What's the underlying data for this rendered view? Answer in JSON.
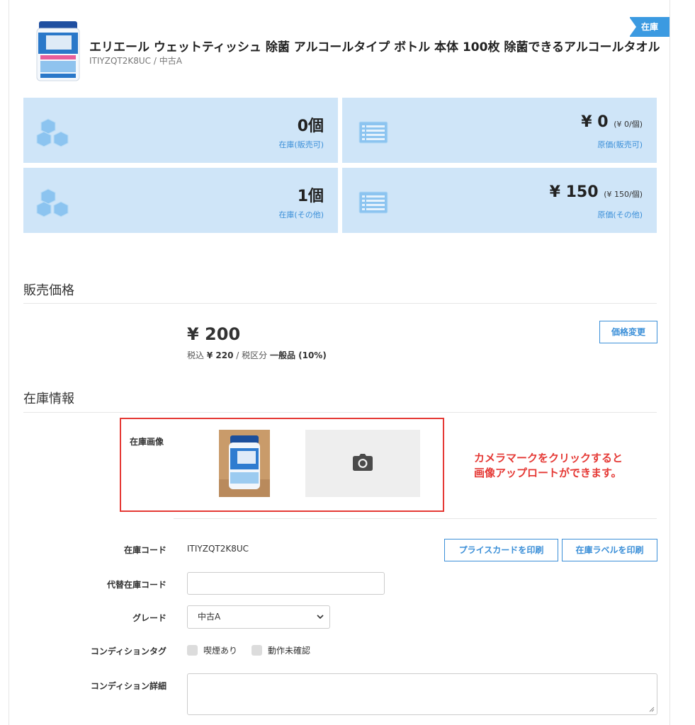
{
  "header": {
    "badge": "在庫",
    "title": "エリエール ウェットティッシュ 除菌 アルコールタイプ ボトル 本体 100枚 除菌できるアルコールタオル",
    "subtitle": "ITIYZQT2K8UC / 中古A"
  },
  "stats": [
    {
      "value": "0個",
      "sub": "",
      "label": "在庫(販売可)",
      "icon": "cubes-icon"
    },
    {
      "value": "¥ 0",
      "sub": "(¥ 0/個)",
      "label": "原価(販売可)",
      "icon": "list-icon"
    },
    {
      "value": "1個",
      "sub": "",
      "label": "在庫(その他)",
      "icon": "cubes-icon"
    },
    {
      "value": "¥ 150",
      "sub": "(¥ 150/個)",
      "label": "原価(その他)",
      "icon": "list-icon"
    }
  ],
  "price_section": {
    "title": "販売価格",
    "price": "¥ 200",
    "tax_prefix": "税込",
    "tax_price": "¥ 220",
    "tax_sep": "/ 税区分",
    "tax_class": "一般品 (10%)",
    "change_button": "価格変更"
  },
  "stock_section": {
    "title": "在庫情報",
    "image_label": "在庫画像",
    "note_line1": "カメラマークをクリックすると",
    "note_line2": "画像アップロートができます。",
    "code_label": "在庫コード",
    "code_value": "ITIYZQT2K8UC",
    "print_price_card": "プライスカードを印刷",
    "print_stock_label": "在庫ラベルを印刷",
    "alt_code_label": "代替在庫コード",
    "alt_code_value": "",
    "grade_label": "グレード",
    "grade_value": "中古A",
    "condition_tag_label": "コンディションタグ",
    "condition_tags": [
      "喫煙あり",
      "動作未確認"
    ],
    "condition_detail_label": "コンディション詳細",
    "condition_detail_value": ""
  },
  "colors": {
    "accent": "#3b8fd8",
    "stat_bg": "#cfe5f8",
    "badge": "#3b9ae1",
    "highlight": "#e53935"
  }
}
